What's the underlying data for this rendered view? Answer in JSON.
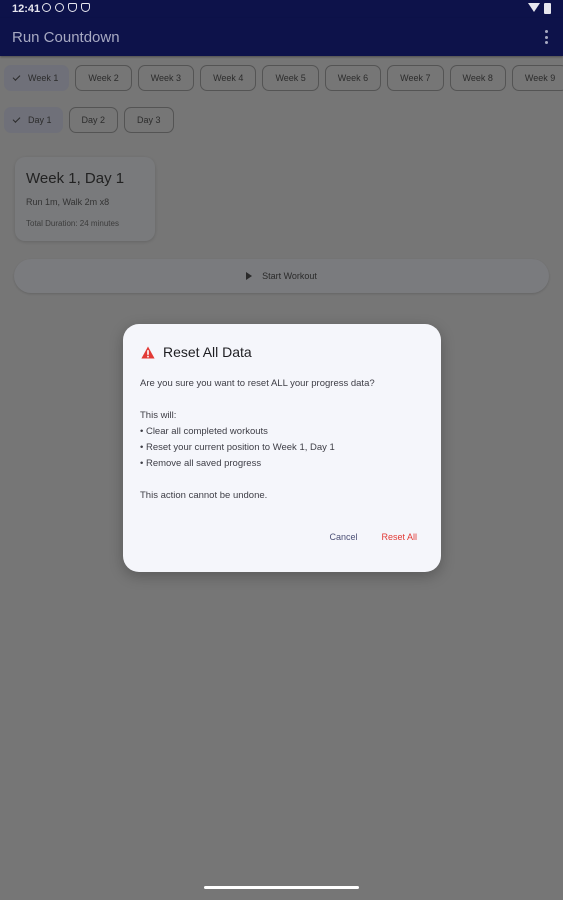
{
  "status_bar": {
    "time": "12:41"
  },
  "app_bar": {
    "title": "Run Countdown"
  },
  "weeks": [
    "Week 1",
    "Week 2",
    "Week 3",
    "Week 4",
    "Week 5",
    "Week 6",
    "Week 7",
    "Week 8",
    "Week 9"
  ],
  "days": [
    "Day 1",
    "Day 2",
    "Day 3"
  ],
  "card": {
    "title": "Week 1, Day 1",
    "description": "Run 1m, Walk 2m x8",
    "duration": "Total Duration: 24 minutes"
  },
  "start_button": {
    "label": "Start Workout"
  },
  "dialog": {
    "title": "Reset All Data",
    "question": "Are you sure you want to reset ALL your progress data?",
    "intro": "This will:",
    "bullets": [
      "• Clear all completed workouts",
      "• Reset your current position to Week 1, Day 1",
      "• Remove all saved progress"
    ],
    "warning": "This action cannot be undone.",
    "cancel_label": "Cancel",
    "reset_label": "Reset All"
  },
  "colors": {
    "app_bar": "#0d124a",
    "scrim": "#767676",
    "dialog_bg": "#f5f6fb",
    "danger": "#e23a36",
    "accent": "#4b4f75"
  },
  "icons": {
    "overflow": "more-vert-icon",
    "check": "check-icon",
    "play": "play-icon",
    "warning": "warning-triangle-icon"
  }
}
